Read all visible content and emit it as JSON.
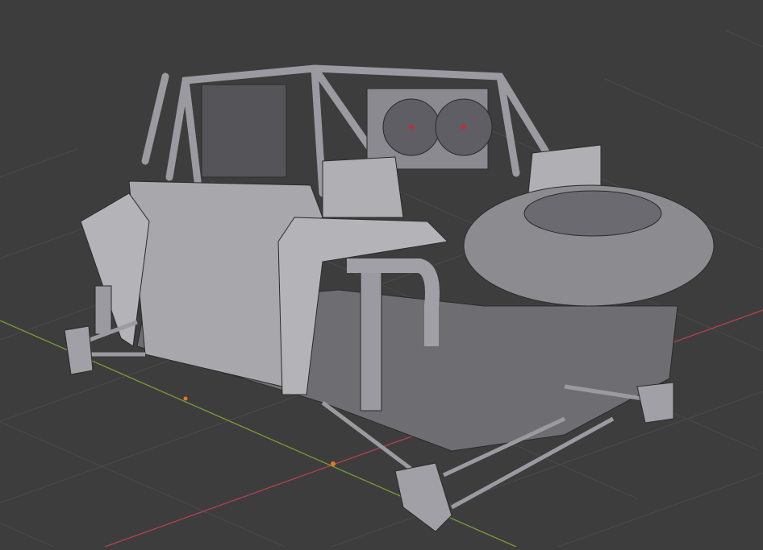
{
  "viewport": {
    "mode": "3d-viewport-wireframe-overlay",
    "colors": {
      "background": "#3d3d3d",
      "grid": "#4a4a4a",
      "x_axis": "#b3414f",
      "y_axis": "#7a9a36",
      "mesh_surface": "#a8a8ac",
      "mesh_shadow": "#6e6e72",
      "wire": "#2a2a2a",
      "origin_point": "#e8742a"
    },
    "object": "off-road-buggy-mesh"
  }
}
